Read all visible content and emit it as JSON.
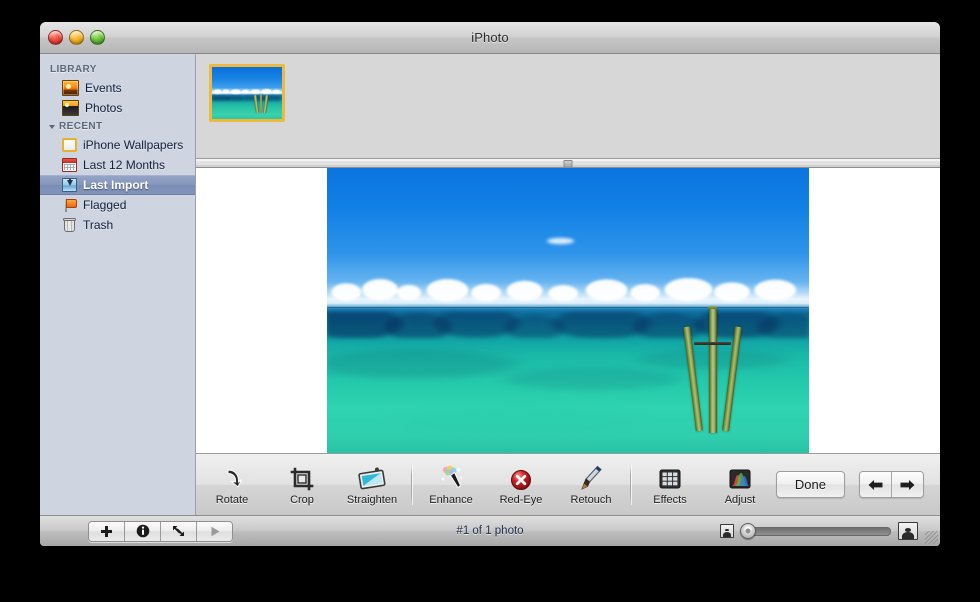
{
  "window": {
    "title": "iPhoto",
    "controls": {
      "close": "close",
      "minimize": "minimize",
      "zoom": "zoom"
    }
  },
  "sidebar": {
    "sections": [
      {
        "header": "LIBRARY",
        "collapsible": false,
        "items": [
          {
            "label": "Events",
            "icon": "events-icon",
            "selected": false
          },
          {
            "label": "Photos",
            "icon": "photos-icon",
            "selected": false
          }
        ]
      },
      {
        "header": "RECENT",
        "collapsible": true,
        "items": [
          {
            "label": "iPhone Wallpapers",
            "icon": "album-icon",
            "selected": false
          },
          {
            "label": "Last 12 Months",
            "icon": "calendar-icon",
            "selected": false
          },
          {
            "label": "Last Import",
            "icon": "import-icon",
            "selected": true
          },
          {
            "label": "Flagged",
            "icon": "flag-icon",
            "selected": false
          },
          {
            "label": "Trash",
            "icon": "trash-icon",
            "selected": false
          }
        ]
      }
    ]
  },
  "browser": {
    "thumbnails": [
      {
        "selected": true,
        "alt": "ocean-pilings-photo",
        "border_color": "#eeb93c"
      }
    ]
  },
  "viewer": {
    "photo_alt": "turquoise-ocean-with-wooden-pilings"
  },
  "edit_toolbar": {
    "groups": [
      {
        "tools": [
          {
            "label": "Rotate",
            "icon": "rotate-icon"
          },
          {
            "label": "Crop",
            "icon": "crop-icon"
          },
          {
            "label": "Straighten",
            "icon": "straighten-icon"
          }
        ]
      },
      {
        "tools": [
          {
            "label": "Enhance",
            "icon": "enhance-wand-icon"
          },
          {
            "label": "Red-Eye",
            "icon": "red-eye-icon"
          },
          {
            "label": "Retouch",
            "icon": "retouch-brush-icon"
          }
        ]
      },
      {
        "tools": [
          {
            "label": "Effects",
            "icon": "effects-grid-icon"
          },
          {
            "label": "Adjust",
            "icon": "adjust-histogram-icon"
          }
        ]
      }
    ],
    "done_label": "Done",
    "previous_label": "previous-photo",
    "next_label": "next-photo"
  },
  "status_bar": {
    "buttons": [
      {
        "icon": "plus-icon",
        "name": "add-button"
      },
      {
        "icon": "info-icon",
        "name": "info-button"
      },
      {
        "icon": "fullscreen-icon",
        "name": "fullscreen-button"
      },
      {
        "icon": "play-icon",
        "name": "slideshow-button"
      }
    ],
    "status_text": "#1 of 1 photo",
    "zoom": {
      "min_icon": "small-thumbnail-icon",
      "max_icon": "large-thumbnail-icon",
      "value": 0
    }
  },
  "colors": {
    "sidebar_bg": "#ced4e0",
    "selection": "#8496bd",
    "thumb_border": "#eeb93c",
    "window_chrome": "#d7d7d7"
  }
}
